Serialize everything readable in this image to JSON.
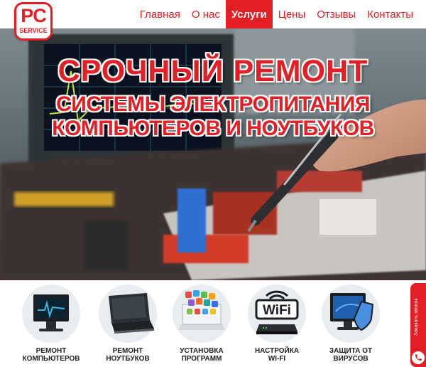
{
  "logo": {
    "top": "PC",
    "bottom": "SERVICE"
  },
  "nav": {
    "items": [
      {
        "label": "Главная",
        "active": false
      },
      {
        "label": "О нас",
        "active": false
      },
      {
        "label": "Услуги",
        "active": true
      },
      {
        "label": "Цены",
        "active": false
      },
      {
        "label": "Отзывы",
        "active": false
      },
      {
        "label": "Контакты",
        "active": false
      }
    ]
  },
  "hero": {
    "line1": "СРОЧНЫЙ РЕМОНТ",
    "line2": "СИСТЕМЫ ЭЛЕКТРОПИТАНИЯ",
    "line3": "КОМПЬЮТЕРОВ И НОУТБУКОВ"
  },
  "services": [
    {
      "label": "РЕМОНТ\nКОМПЬЮТЕРОВ",
      "icon": "computer-icon"
    },
    {
      "label": "РЕМОНТ\nНОУТБУКОВ",
      "icon": "laptop-icon"
    },
    {
      "label": "УСТАНОВКА\nПРОГРАММ",
      "icon": "apps-install-icon"
    },
    {
      "label": "НАСТРОЙКА\nWI-FI",
      "icon": "wifi-router-icon"
    },
    {
      "label": "ЗАЩИТА ОТ\nВИРУСОВ",
      "icon": "antivirus-shield-icon"
    }
  ],
  "callback": {
    "label": "Заказать звонок",
    "icon": "phone-icon"
  },
  "colors": {
    "accent": "#e31e24",
    "text": "#222222"
  }
}
